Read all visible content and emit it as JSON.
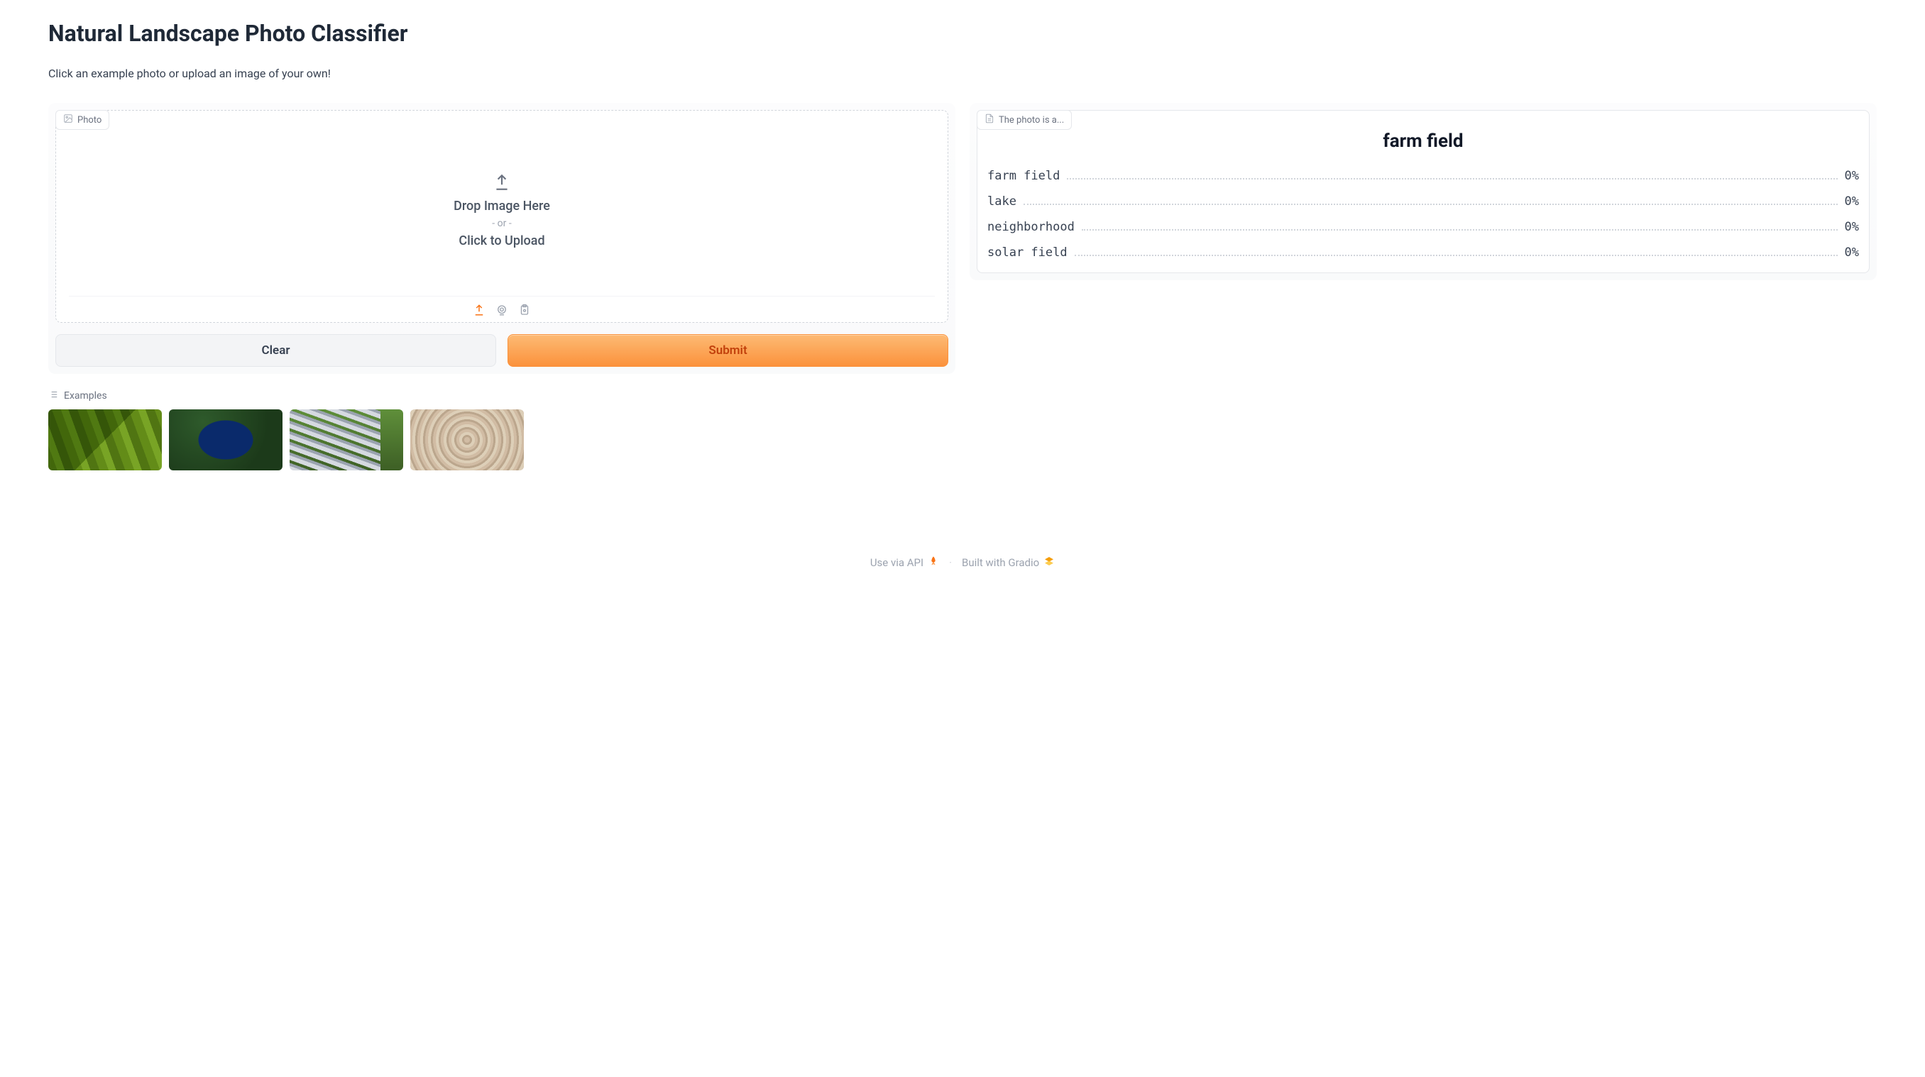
{
  "title": "Natural Landscape Photo Classifier",
  "subtitle": "Click an example photo or upload an image of your own!",
  "input_panel": {
    "label": "Photo",
    "drop_title": "Drop Image Here",
    "drop_or": "- or -",
    "drop_sub": "Click to Upload"
  },
  "buttons": {
    "clear": "Clear",
    "submit": "Submit"
  },
  "output_panel": {
    "label": "The photo is a...",
    "top": "farm field",
    "results": [
      {
        "name": "farm field",
        "pct": "0%"
      },
      {
        "name": "lake",
        "pct": "0%"
      },
      {
        "name": "neighborhood",
        "pct": "0%"
      },
      {
        "name": "solar field",
        "pct": "0%"
      }
    ]
  },
  "examples": {
    "label": "Examples",
    "items": [
      "farm-field",
      "lake",
      "solar-field",
      "neighborhood"
    ]
  },
  "footer": {
    "api": "Use via API",
    "built": "Built with Gradio"
  }
}
